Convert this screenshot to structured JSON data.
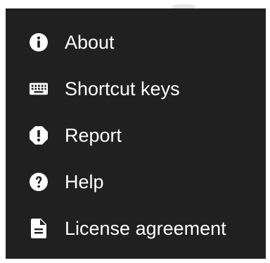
{
  "menu": {
    "items": [
      {
        "label": "About",
        "icon": "info-icon"
      },
      {
        "label": "Shortcut keys",
        "icon": "keyboard-icon"
      },
      {
        "label": "Report",
        "icon": "report-icon"
      },
      {
        "label": "Help",
        "icon": "help-icon"
      },
      {
        "label": "License agreement",
        "icon": "document-icon"
      }
    ]
  },
  "colors": {
    "menu_background": "#202020",
    "text": "#ffffff",
    "page_background": "#ffffff"
  }
}
